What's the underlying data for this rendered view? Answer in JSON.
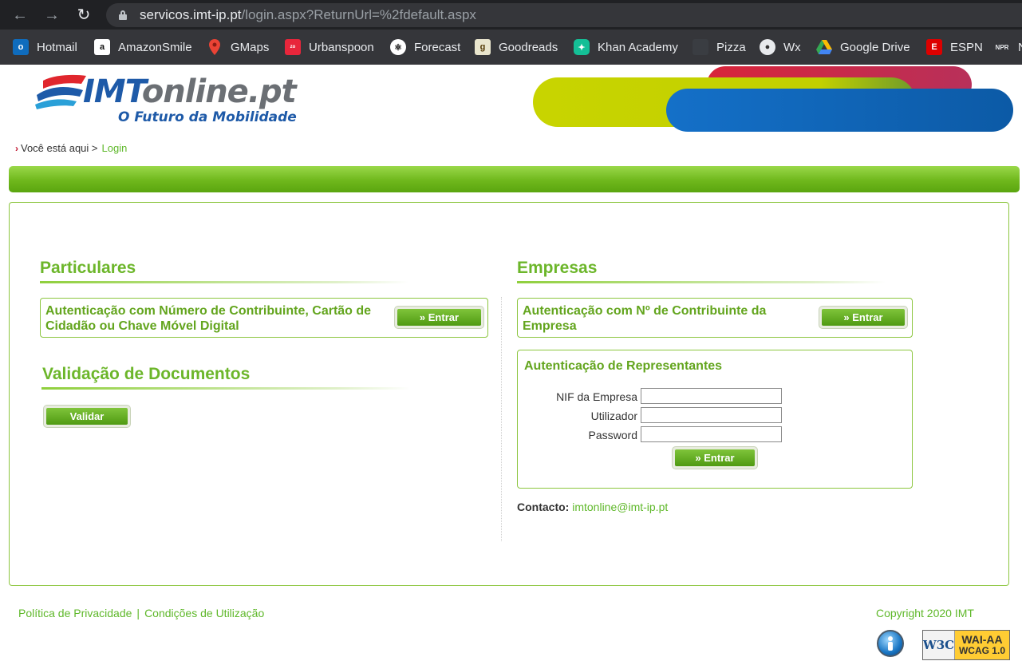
{
  "browser": {
    "url_host": "servicos.imt-ip.pt",
    "url_path": "/login.aspx?ReturnUrl=%2fdefault.aspx",
    "bookmarks": [
      {
        "label": "Hotmail",
        "icon": "outlook-icon",
        "color": "#0f6cbd"
      },
      {
        "label": "AmazonSmile",
        "icon": "amazon-icon",
        "color": "#ffffff"
      },
      {
        "label": "GMaps",
        "icon": "maps-pin-icon",
        "color": "#ea4335"
      },
      {
        "label": "Urbanspoon",
        "icon": "urbanspoon-icon",
        "color": "#e8263b"
      },
      {
        "label": "Forecast",
        "icon": "forecast-icon",
        "color": "#ffffff"
      },
      {
        "label": "Goodreads",
        "icon": "goodreads-icon",
        "color": "#e9e5cd"
      },
      {
        "label": "Khan Academy",
        "icon": "khan-academy-icon",
        "color": "#14bf96"
      },
      {
        "label": "Pizza",
        "icon": "pizza-icon",
        "color": "#3a3d42"
      },
      {
        "label": "Wx",
        "icon": "globe-icon",
        "color": "#e8eaed"
      },
      {
        "label": "Google Drive",
        "icon": "google-drive-icon",
        "color": "#34a853"
      },
      {
        "label": "ESPN",
        "icon": "espn-icon",
        "color": "#d00"
      },
      {
        "label": "N",
        "icon": "npr-icon",
        "color": "#e8eaed"
      }
    ]
  },
  "header": {
    "logo_imt": "IMT",
    "logo_online": "online.pt",
    "logo_tagline": "O Futuro da Mobilidade"
  },
  "breadcrumb": {
    "prefix": "Você está aqui >",
    "current": "Login"
  },
  "particulares": {
    "title": "Particulares",
    "auth_text_line1": "Autenticação com Número de Contribuinte, Cartão de",
    "auth_text_line2": "Cidadão ou Chave Móvel Digital",
    "enter_label": "» Entrar"
  },
  "validacao": {
    "title": "Validação de Documentos",
    "validate_label": "Validar"
  },
  "empresas": {
    "title": "Empresas",
    "auth_text_line1": "Autenticação com Nº de Contribuinte da",
    "auth_text_line2": "Empresa",
    "enter_label": "» Entrar"
  },
  "representantes": {
    "title": "Autenticação de Representantes",
    "nif_label": "NIF da Empresa",
    "nif_value": "",
    "user_label": "Utilizador",
    "user_value": "",
    "password_label": "Password",
    "password_value": "",
    "enter_label": "» Entrar"
  },
  "contact": {
    "label": "Contacto:",
    "email": "imtonline@imt-ip.pt"
  },
  "footer": {
    "privacy": "Política de Privacidade",
    "separator": "|",
    "terms": "Condições de Utilização",
    "copyright": "Copyright 2020 IMT",
    "w3c_logo": "W3C",
    "w3c_line1": "WAI-AA",
    "w3c_line2": "WCAG 1.0"
  },
  "colors": {
    "brand_green": "#6cb62a",
    "brand_blue": "#1e5aa8",
    "link_green": "#5fb82a"
  }
}
